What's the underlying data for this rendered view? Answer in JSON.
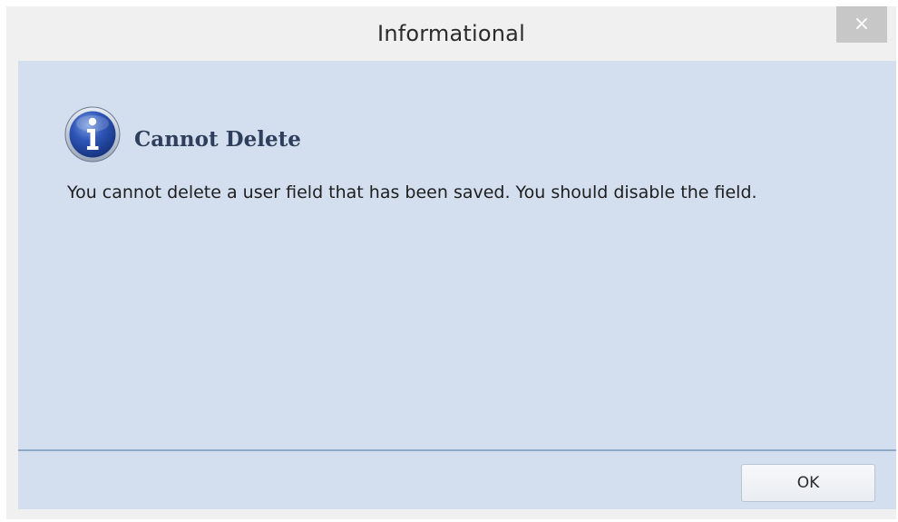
{
  "window": {
    "title": "Informational",
    "close_label": "×"
  },
  "dialog": {
    "icon": "info-icon",
    "heading": "Cannot Delete",
    "message": "You cannot delete a user field that has been saved.  You should disable the field."
  },
  "footer": {
    "ok_label": "OK"
  },
  "colors": {
    "body_background": "#d3dfee",
    "divider": "#8fa9c8",
    "heading": "#2f3e5c",
    "close_button": "#c7c7c7"
  }
}
